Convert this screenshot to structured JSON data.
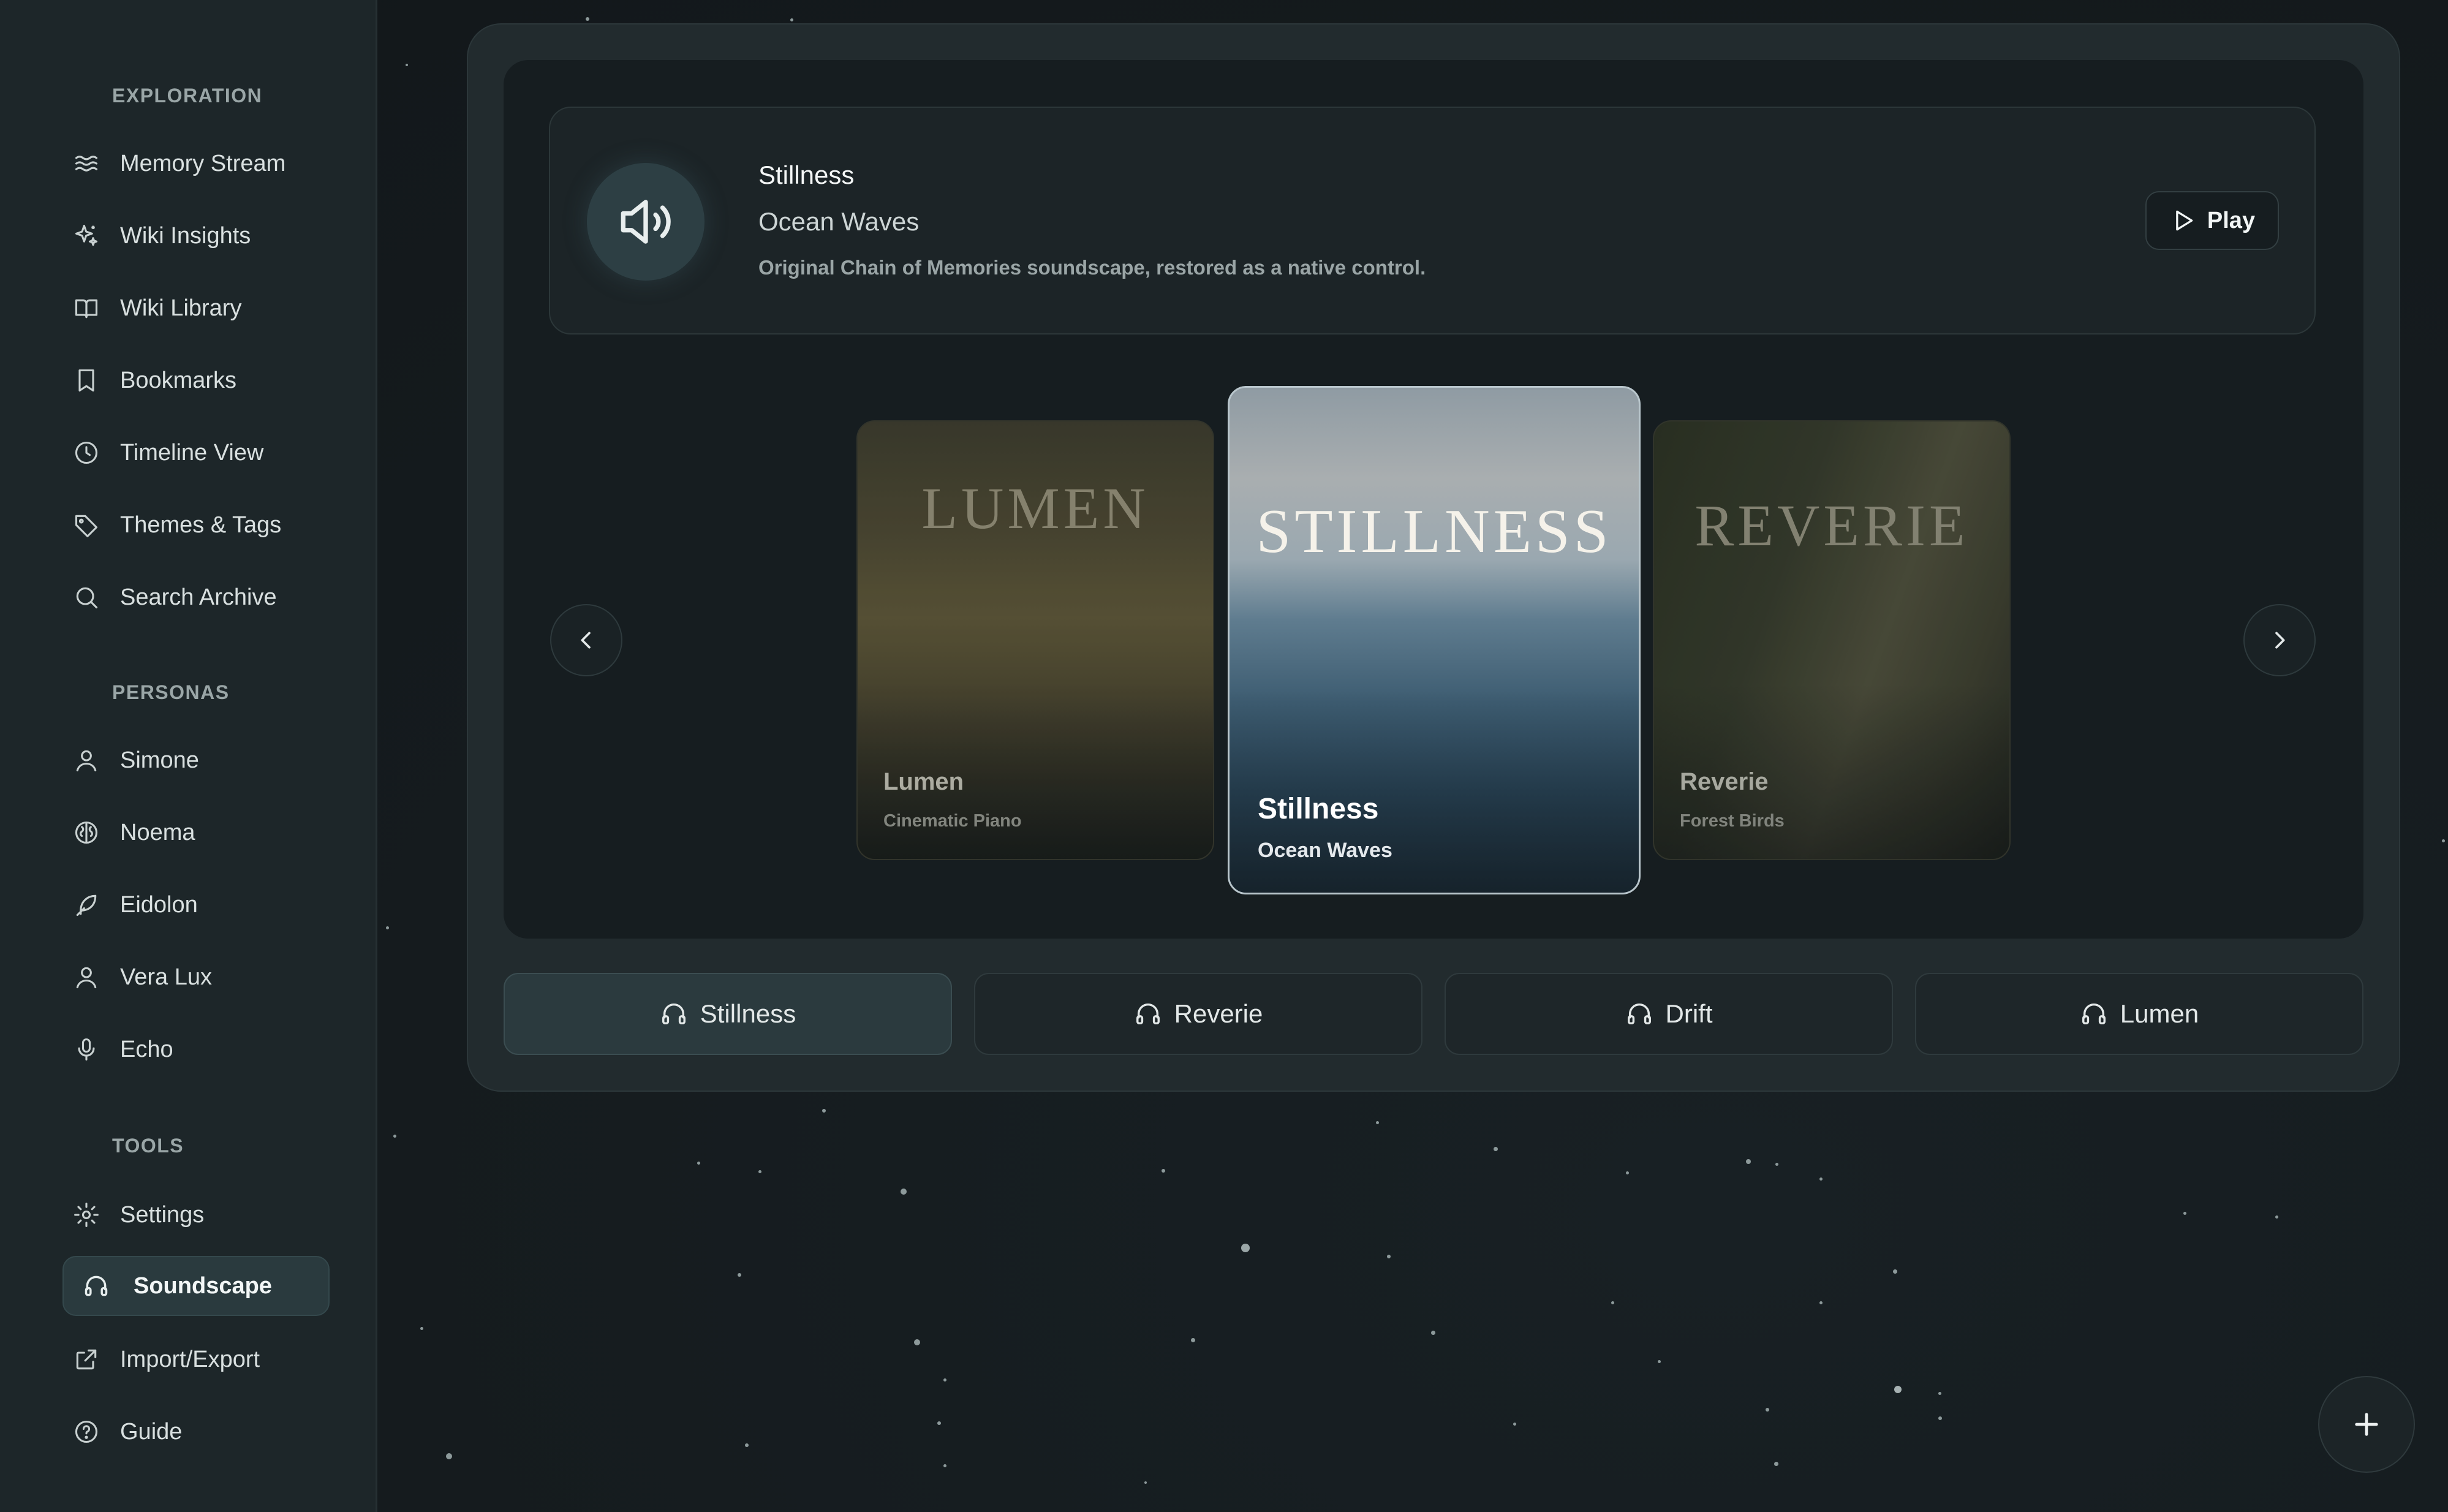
{
  "sidebar": {
    "sections": [
      {
        "title": "EXPLORATION",
        "items": [
          {
            "label": "Memory Stream",
            "icon": "waves-icon"
          },
          {
            "label": "Wiki Insights",
            "icon": "sparkles-icon"
          },
          {
            "label": "Wiki Library",
            "icon": "open-book-icon"
          },
          {
            "label": "Bookmarks",
            "icon": "bookmark-icon"
          },
          {
            "label": "Timeline View",
            "icon": "clock-icon"
          },
          {
            "label": "Themes & Tags",
            "icon": "tag-icon"
          },
          {
            "label": "Search Archive",
            "icon": "search-icon"
          }
        ]
      },
      {
        "title": "PERSONAS",
        "items": [
          {
            "label": "Simone",
            "icon": "user-icon"
          },
          {
            "label": "Noema",
            "icon": "brain-icon"
          },
          {
            "label": "Eidolon",
            "icon": "feather-icon"
          },
          {
            "label": "Vera Lux",
            "icon": "user-icon"
          },
          {
            "label": "Echo",
            "icon": "microphone-icon"
          }
        ]
      },
      {
        "title": "TOOLS",
        "items": [
          {
            "label": "Settings",
            "icon": "gear-icon"
          },
          {
            "label": "Soundscape",
            "icon": "headphones-icon",
            "active": true
          },
          {
            "label": "Import/Export",
            "icon": "external-link-icon"
          },
          {
            "label": "Guide",
            "icon": "help-circle-icon"
          }
        ]
      }
    ]
  },
  "now_playing": {
    "title": "Stillness",
    "subtitle": "Ocean Waves",
    "description": "Original Chain of Memories soundscape, restored as a native control.",
    "play_label": "Play",
    "icon": "speaker-icon"
  },
  "carousel": {
    "cards": [
      {
        "art_title": "LUMEN",
        "name": "Lumen",
        "sub": "Cinematic Piano"
      },
      {
        "art_title": "STILLNESS",
        "name": "Stillness",
        "sub": "Ocean Waves"
      },
      {
        "art_title": "REVERIE",
        "name": "Reverie",
        "sub": "Forest Birds"
      }
    ],
    "prev_icon": "chevron-left-icon",
    "next_icon": "chevron-right-icon"
  },
  "tabs": [
    {
      "label": "Stillness",
      "active": true
    },
    {
      "label": "Reverie"
    },
    {
      "label": "Drift"
    },
    {
      "label": "Lumen"
    }
  ],
  "fab": {
    "icon": "plus-icon"
  },
  "colors": {
    "accent": "#2b3a3e",
    "background": "#151b1e",
    "sidebar": "#1d2629"
  }
}
